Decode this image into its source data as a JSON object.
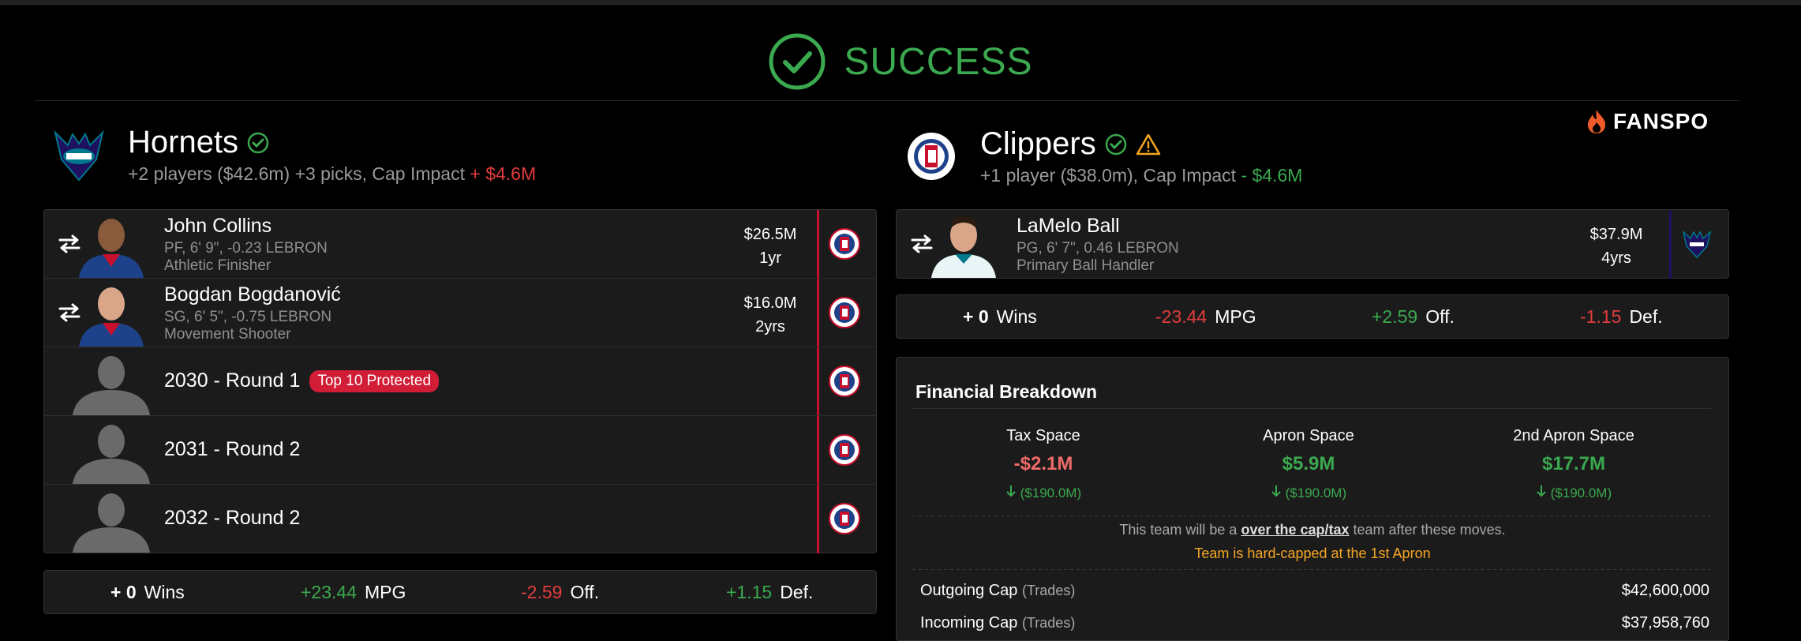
{
  "status": {
    "text": "SUCCESS"
  },
  "brand": {
    "name": "FANSPO"
  },
  "left_team": {
    "name": "Hornets",
    "summary": "+2 players ($42.6m) +3 picks, Cap Impact ",
    "cap_impact": "+ $4.6M",
    "assets": [
      {
        "name": "John Collins",
        "info": "PF, 6' 9\", -0.23 LEBRON",
        "role": "Athletic Finisher",
        "salary": "$26.5M",
        "years": "1yr"
      },
      {
        "name": "Bogdan Bogdanović",
        "info": "SG, 6' 5\", -0.75 LEBRON",
        "role": "Movement Shooter",
        "salary": "$16.0M",
        "years": "2yrs"
      }
    ],
    "picks": [
      {
        "name": "2030 - Round 1",
        "badge": "Top 10 Protected"
      },
      {
        "name": "2031 - Round 2"
      },
      {
        "name": "2032 - Round 2"
      }
    ],
    "stats": {
      "wins_val": "+ 0",
      "wins_label": "Wins",
      "mpg_val": "+23.44",
      "mpg_label": "MPG",
      "off_val": "-2.59",
      "off_label": "Off.",
      "def_val": "+1.15",
      "def_label": "Def."
    }
  },
  "right_team": {
    "name": "Clippers",
    "summary": "+1 player ($38.0m), Cap Impact ",
    "cap_impact": "- $4.6M",
    "assets": [
      {
        "name": "LaMelo Ball",
        "info": "PG, 6' 7\", 0.46 LEBRON",
        "role": "Primary Ball Handler",
        "salary": "$37.9M",
        "years": "4yrs"
      }
    ],
    "stats": {
      "wins_val": "+ 0",
      "wins_label": "Wins",
      "mpg_val": "-23.44",
      "mpg_label": "MPG",
      "off_val": "+2.59",
      "off_label": "Off.",
      "def_val": "-1.15",
      "def_label": "Def."
    }
  },
  "financial": {
    "title": "Financial Breakdown",
    "columns": [
      {
        "label": "Tax Space",
        "value": "-$2.1M",
        "change": "($190.0M)"
      },
      {
        "label": "Apron Space",
        "value": "$5.9M",
        "change": "($190.0M)"
      },
      {
        "label": "2nd Apron Space",
        "value": "$17.7M",
        "change": "($190.0M)"
      }
    ],
    "note_pre": "This team will be a ",
    "note_link": "over the cap/tax",
    "note_post": " team after these moves.",
    "warning": "Team is hard-capped at the 1st Apron",
    "outgoing_label": "Outgoing Cap",
    "outgoing_sub": "(Trades)",
    "outgoing_value": "$42,600,000",
    "incoming_label": "Incoming Cap",
    "incoming_sub": "(Trades)",
    "incoming_value": "$37,958,760"
  },
  "colors": {
    "success": "#3ba94f",
    "negative": "#e23c3c",
    "warning": "#f5a623",
    "clippers_red": "#c8102e",
    "hornets_purple": "#1d1160"
  }
}
